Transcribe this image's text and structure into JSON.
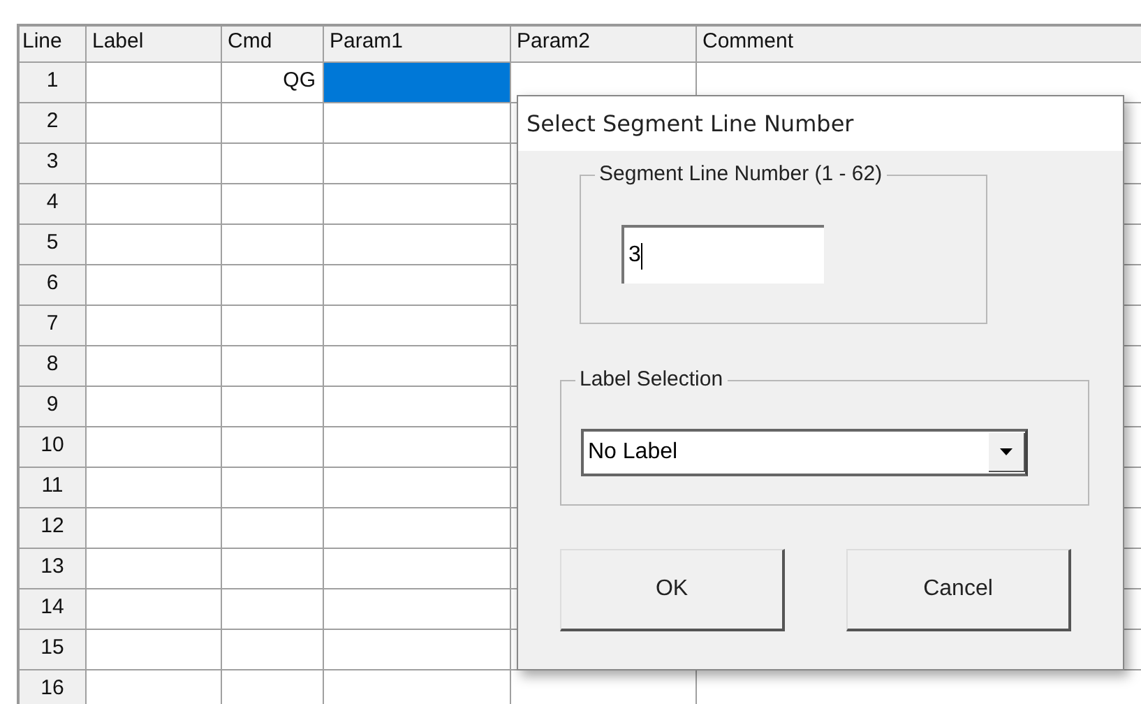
{
  "table": {
    "columns": [
      "Line",
      "Label",
      "Cmd",
      "Param1",
      "Param2",
      "Comment"
    ],
    "rows": [
      {
        "line": "1",
        "cmd": "QG",
        "param1_selected": true
      },
      {
        "line": "2",
        "param1_selected": false
      },
      {
        "line": "3",
        "param1_selected": false
      },
      {
        "line": "4",
        "param1_selected": false
      },
      {
        "line": "5",
        "param1_selected": false
      },
      {
        "line": "6",
        "param1_selected": false
      },
      {
        "line": "7",
        "param1_selected": false
      },
      {
        "line": "8",
        "param1_selected": false
      },
      {
        "line": "9",
        "param1_selected": false
      },
      {
        "line": "10",
        "param1_selected": false
      },
      {
        "line": "11",
        "param1_selected": false
      },
      {
        "line": "12",
        "param1_selected": false
      },
      {
        "line": "13",
        "param1_selected": false
      },
      {
        "line": "14",
        "param1_selected": false
      },
      {
        "line": "15",
        "param1_selected": false
      },
      {
        "line": "16",
        "param1_selected": false
      }
    ]
  },
  "dialog": {
    "title": "Select Segment Line Number",
    "segment_group": {
      "label": "Segment Line Number (1 - 62)",
      "value": "3",
      "focused": true
    },
    "label_group": {
      "label": "Label Selection",
      "value": "No Label"
    },
    "buttons": [
      "OK",
      "Cancel"
    ]
  }
}
